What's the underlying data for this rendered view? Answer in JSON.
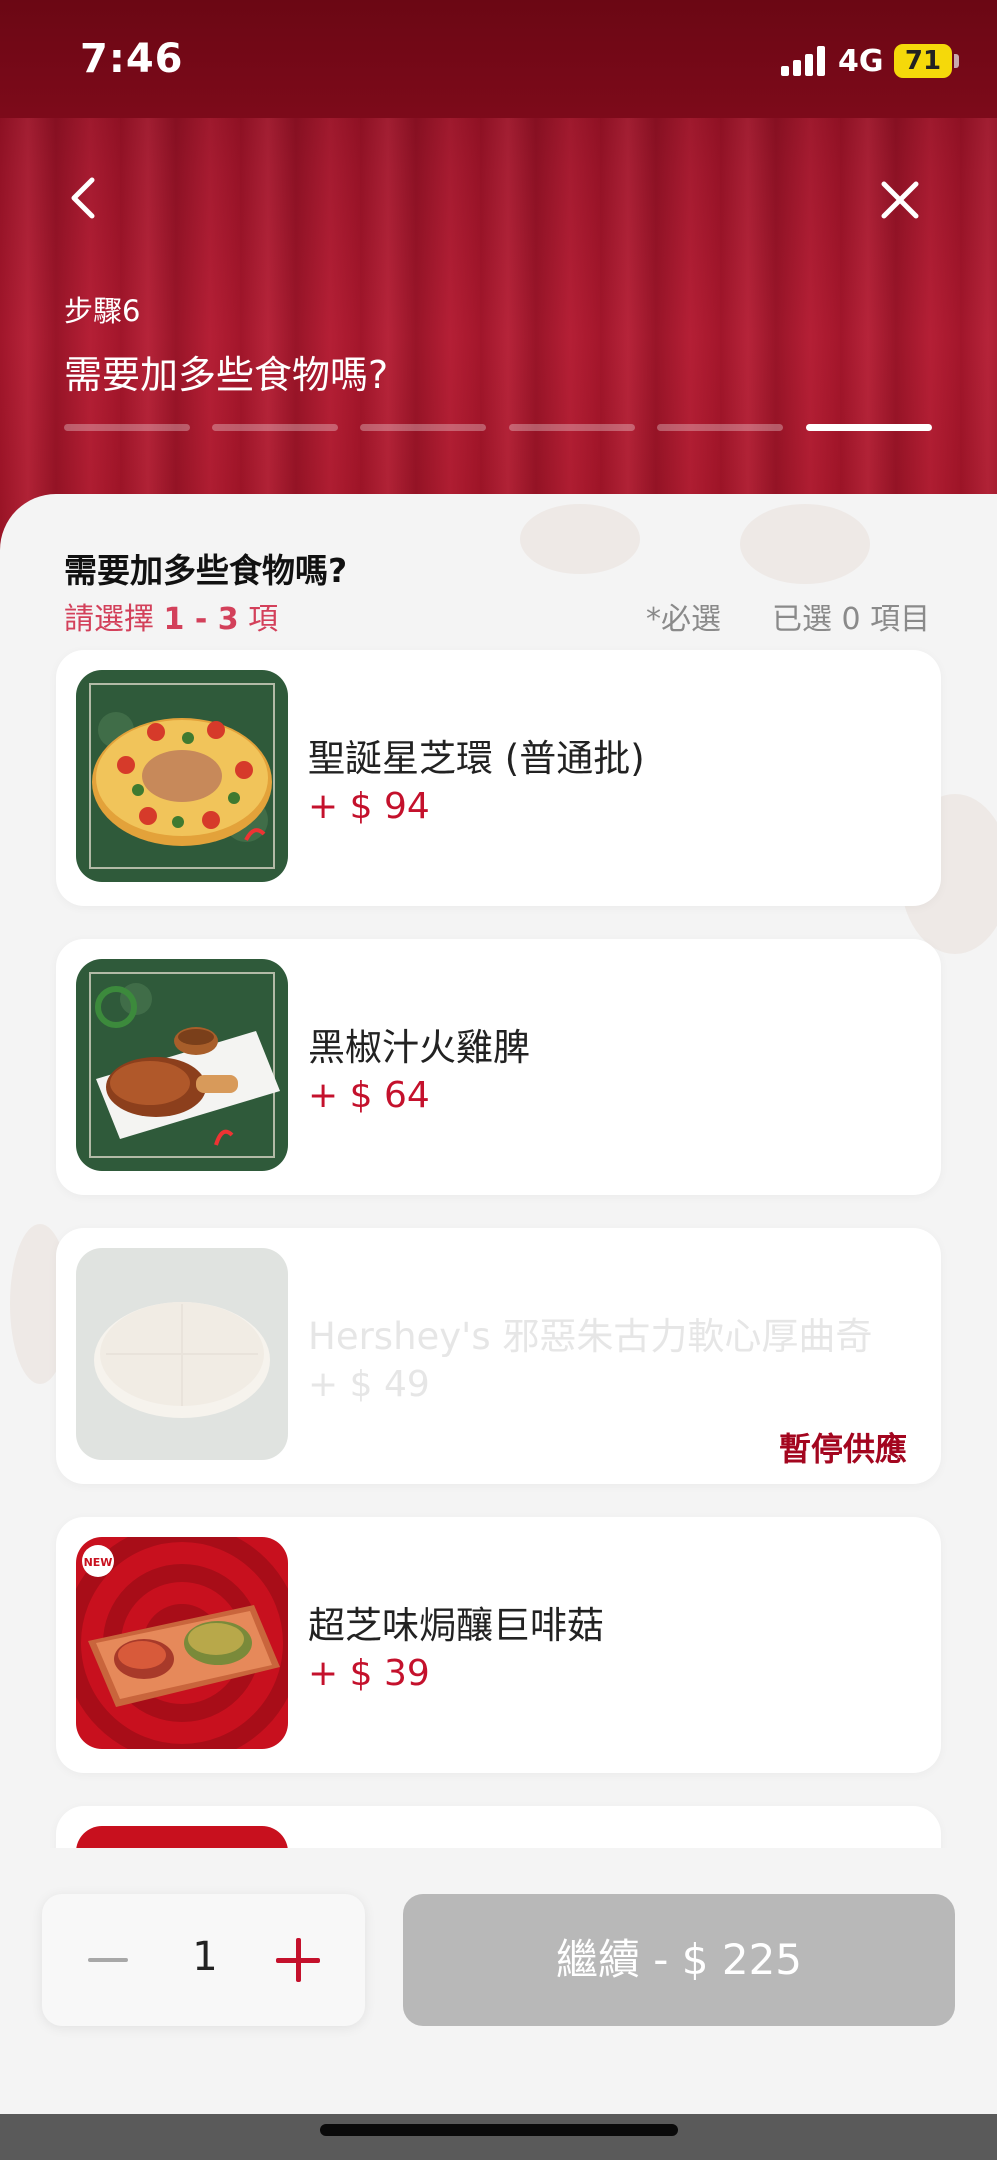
{
  "status_bar": {
    "time": "7:46",
    "network": "4G",
    "battery": "71"
  },
  "header": {
    "step_label": "步驟6",
    "title": "需要加多些食物嗎?",
    "progress": {
      "total_steps": 6,
      "current_step": 6
    }
  },
  "section": {
    "title": "需要加多些食物嗎?",
    "choose_prefix": "請選擇 ",
    "choose_range": "1 - 3",
    "choose_suffix": " 項",
    "required": "*必選",
    "selected": "已選 0 項目"
  },
  "items": [
    {
      "name": "聖誕星芝環 (普通批)",
      "price": "+ $ 94",
      "image": "christmas-pizza-ring",
      "available": true
    },
    {
      "name": "黑椒汁火雞脾",
      "price": "+ $ 64",
      "image": "turkey-leg",
      "available": true
    },
    {
      "name": "Hershey's 邪惡朱古力軟心厚曲奇",
      "price": "+ $ 49",
      "image": "chocolate-cookie",
      "available": false,
      "status": "暫停供應"
    },
    {
      "name": "超芝味焗釀巨啡菇",
      "price": "+ $ 39",
      "image": "baked-mushrooms",
      "available": true,
      "badge": "NEW"
    }
  ],
  "footer": {
    "quantity": "1",
    "continue_label": "繼續 - $ 225"
  },
  "colors": {
    "brand_red": "#c4112c",
    "header_red": "#a3142a",
    "disabled_button": "#b8b8b8"
  }
}
